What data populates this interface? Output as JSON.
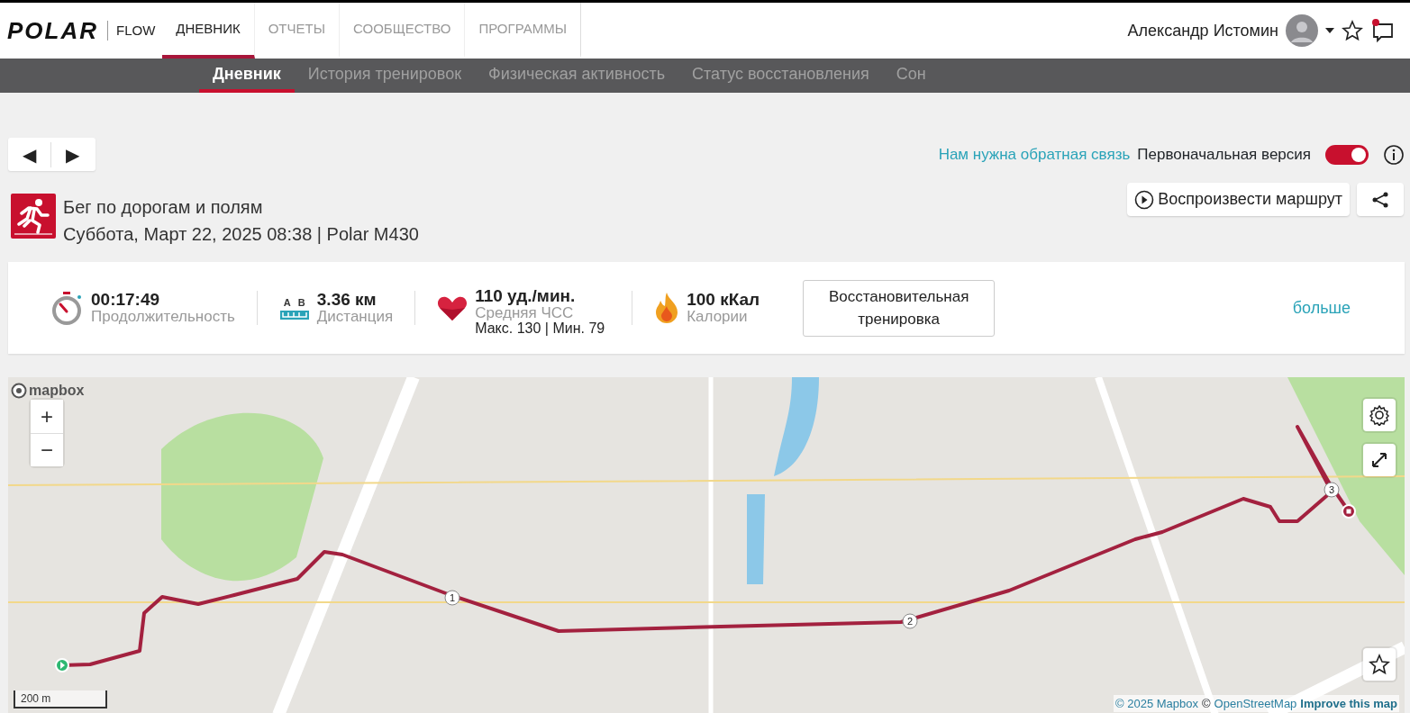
{
  "header": {
    "logo": "POLAR",
    "product": "FLOW",
    "nav": [
      {
        "label": "ДНЕВНИК",
        "selected": true
      },
      {
        "label": "ОТЧЕТЫ",
        "selected": false
      },
      {
        "label": "СООБЩЕСТВО",
        "selected": false
      },
      {
        "label": "ПРОГРАММЫ",
        "selected": false
      }
    ],
    "user": {
      "name": "Александр Истомин"
    },
    "notifications": {
      "unread": true
    }
  },
  "subnav": [
    {
      "label": "Дневник",
      "selected": true
    },
    {
      "label": "История тренировок",
      "selected": false
    },
    {
      "label": "Физическая активность",
      "selected": false
    },
    {
      "label": "Статус восстановления",
      "selected": false
    },
    {
      "label": "Сон",
      "selected": false
    }
  ],
  "pager": {
    "prev": "◀",
    "next": "▶"
  },
  "feedback_link": "Нам нужна обратная связь",
  "version_toggle": {
    "label": "Первоначальная версия",
    "on": true
  },
  "session": {
    "title": "Бег по дорогам и полям",
    "subtitle": "Суббота, Март 22, 2025 08:38 | Polar M430"
  },
  "replay_button": "Воспроизвести маршрут",
  "stats": [
    {
      "kind": "duration",
      "value": "00:17:49",
      "label": "Продолжительность"
    },
    {
      "kind": "distance",
      "value": "3.36 км",
      "label": "Дистанция",
      "marks": [
        "A",
        "B"
      ]
    },
    {
      "kind": "heart_rate",
      "value": "110 уд./мин.",
      "label": "Средняя ЧСС",
      "detail": "Макс. 130  |  Мин. 79"
    },
    {
      "kind": "calories",
      "value": "100 кКал",
      "label": "Калории"
    }
  ],
  "training_benefit": "Восстановительная тренировка",
  "more_link": "больше",
  "map": {
    "logo": "mapbox",
    "zoom_in": "+",
    "zoom_out": "−",
    "km_markers": [
      "1",
      "2",
      "3"
    ],
    "scale": "200 m",
    "attribution": [
      {
        "kind": "link",
        "text": "© 2025 Mapbox"
      },
      {
        "kind": "plain",
        "text": "©"
      },
      {
        "kind": "link",
        "text": "OpenStreetMap"
      },
      {
        "kind": "strong_link",
        "text": "Improve this map"
      }
    ]
  }
}
